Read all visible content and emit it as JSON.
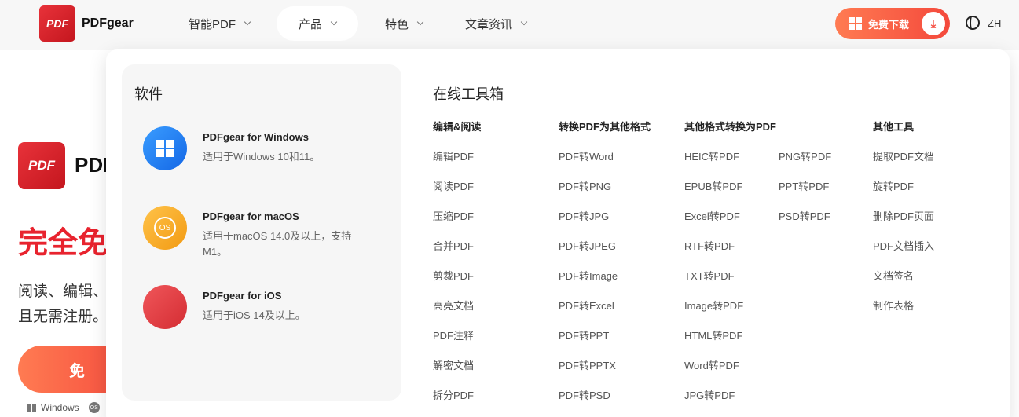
{
  "header": {
    "brand": "PDFgear",
    "logo_text": "PDF",
    "nav": [
      {
        "label": "智能PDF"
      },
      {
        "label": "产品"
      },
      {
        "label": "特色"
      },
      {
        "label": "文章资讯"
      }
    ],
    "download_label": "免费下载",
    "language": "ZH"
  },
  "background": {
    "brand": "PDF",
    "hero": "完全免",
    "desc_line1": "阅读、编辑、",
    "desc_line2": "且无需注册。",
    "cta": "免",
    "os_windows": "Windows",
    "os_mac": "OS"
  },
  "dropdown": {
    "software_title": "软件",
    "software": [
      {
        "name": "PDFgear for Windows",
        "desc": "适用于Windows 10和11。"
      },
      {
        "name": "PDFgear for macOS",
        "desc": "适用于macOS 14.0及以上，支持M1。"
      },
      {
        "name": "PDFgear for iOS",
        "desc": "适用于iOS 14及以上。"
      }
    ],
    "online_title": "在线工具箱",
    "columns": {
      "edit": {
        "title": "编辑&阅读",
        "items": [
          "编辑PDF",
          "阅读PDF",
          "压缩PDF",
          "合并PDF",
          "剪裁PDF",
          "高亮文档",
          "PDF注释",
          "解密文档",
          "拆分PDF"
        ]
      },
      "convert_from": {
        "title": "转换PDF为其他格式",
        "items": [
          "PDF转Word",
          "PDF转PNG",
          "PDF转JPG",
          "PDF转JPEG",
          "PDF转Image",
          "PDF转Excel",
          "PDF转PPT",
          "PDF转PPTX",
          "PDF转PSD"
        ]
      },
      "convert_to": {
        "title": "其他格式转换为PDF",
        "items": [
          "HEIC转PDF",
          "EPUB转PDF",
          "Excel转PDF",
          "RTF转PDF",
          "TXT转PDF",
          "Image转PDF",
          "HTML转PDF",
          "Word转PDF",
          "JPG转PDF"
        ],
        "items2": [
          "PNG转PDF",
          "PPT转PDF",
          "PSD转PDF"
        ]
      },
      "other": {
        "title": "其他工具",
        "items": [
          "提取PDF文档",
          "旋转PDF",
          "删除PDF页面",
          "PDF文档插入",
          "文档签名",
          "制作表格"
        ]
      }
    }
  }
}
